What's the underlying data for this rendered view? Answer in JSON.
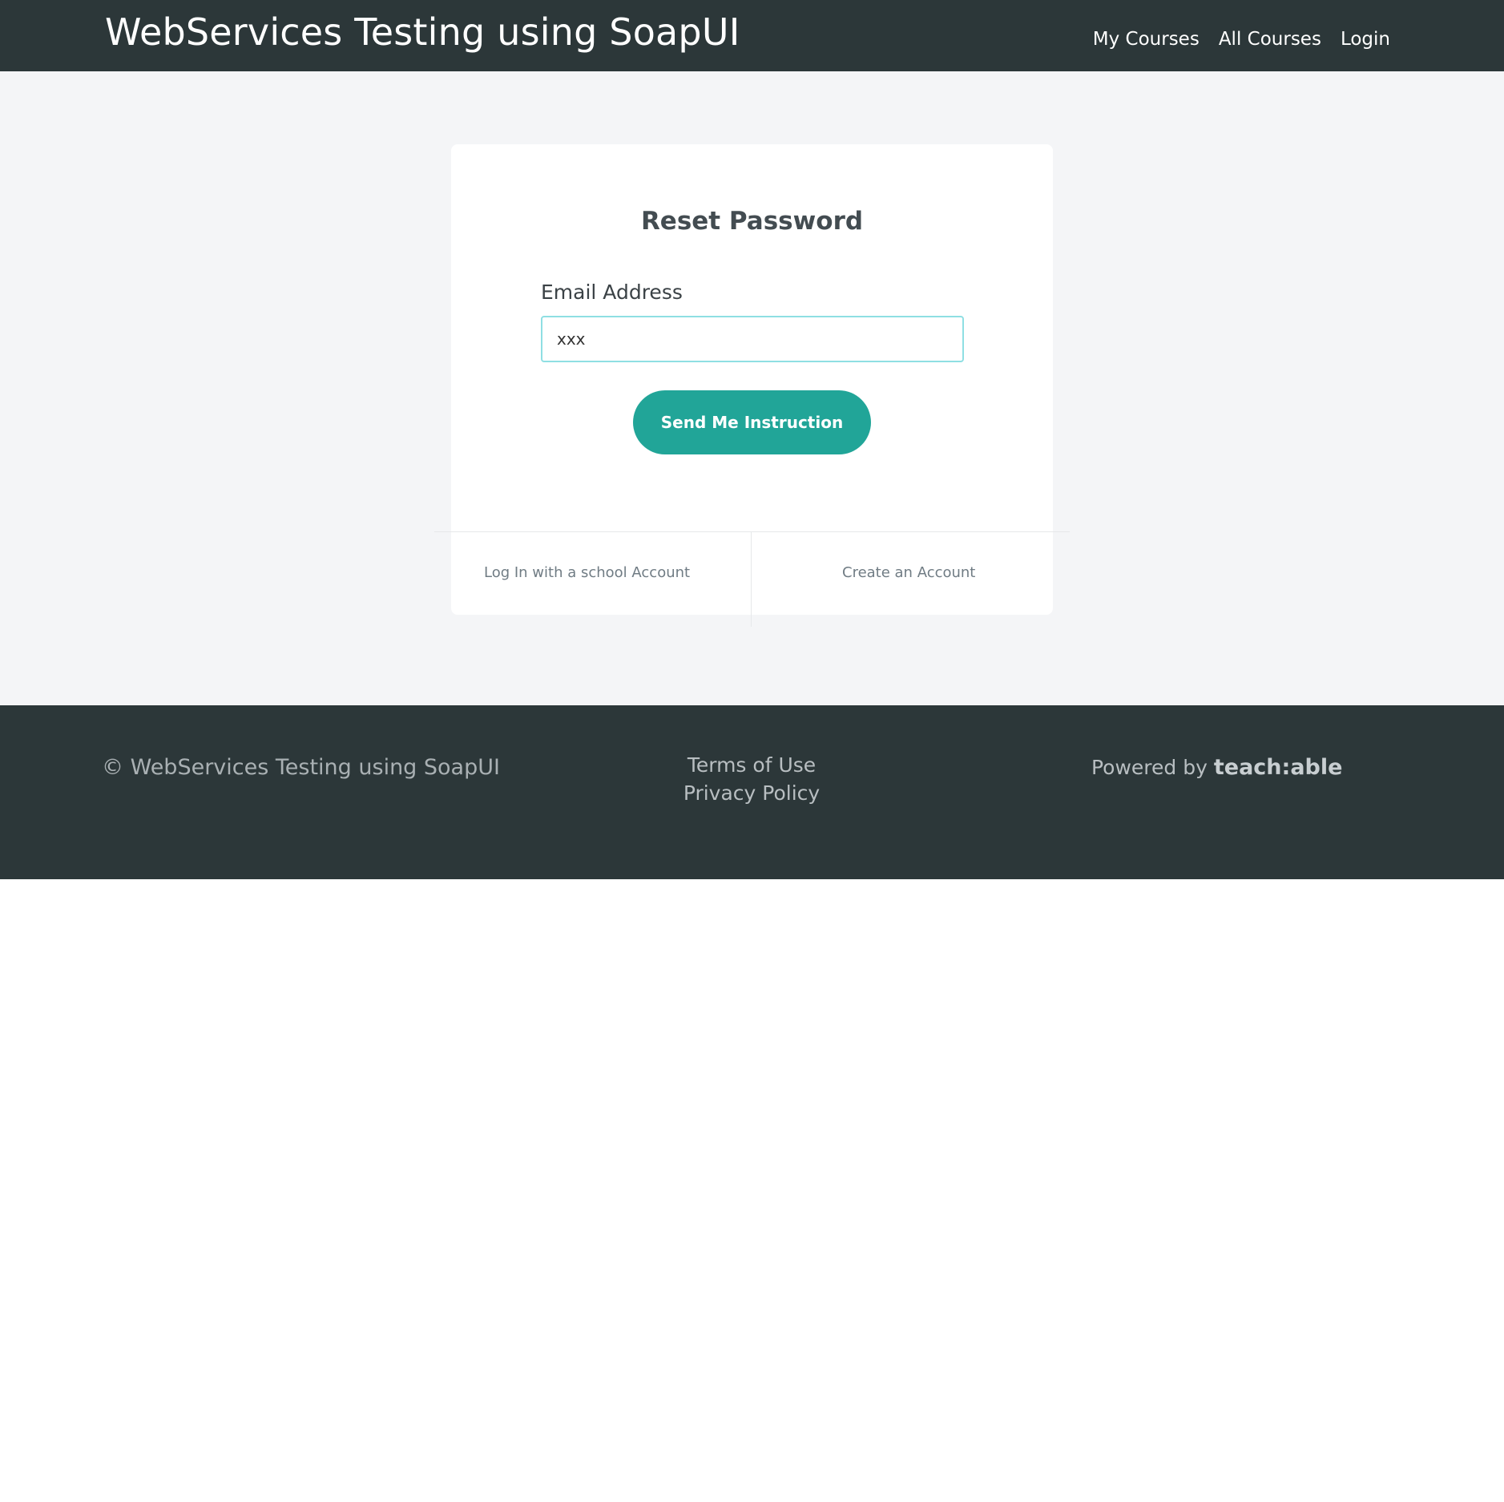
{
  "header": {
    "site_title": "WebServices Testing using SoapUI",
    "nav": {
      "my_courses": "My Courses",
      "all_courses": "All Courses",
      "login": "Login"
    }
  },
  "card": {
    "title": "Reset Password",
    "email_label": "Email Address",
    "email_value": "xxx",
    "submit_label": "Send Me Instruction",
    "school_login_label": "Log In with a school Account",
    "create_account_label": "Create an Account"
  },
  "footer": {
    "copyright": "© WebServices Testing using SoapUI",
    "terms": "Terms of Use",
    "privacy": "Privacy Policy",
    "powered_by": "Powered by",
    "powered_brand": "teach:able"
  },
  "colors": {
    "header_bg": "#2c3739",
    "page_bg": "#f4f5f7",
    "accent": "#21a598",
    "input_focus_border": "#8fdfe3"
  }
}
